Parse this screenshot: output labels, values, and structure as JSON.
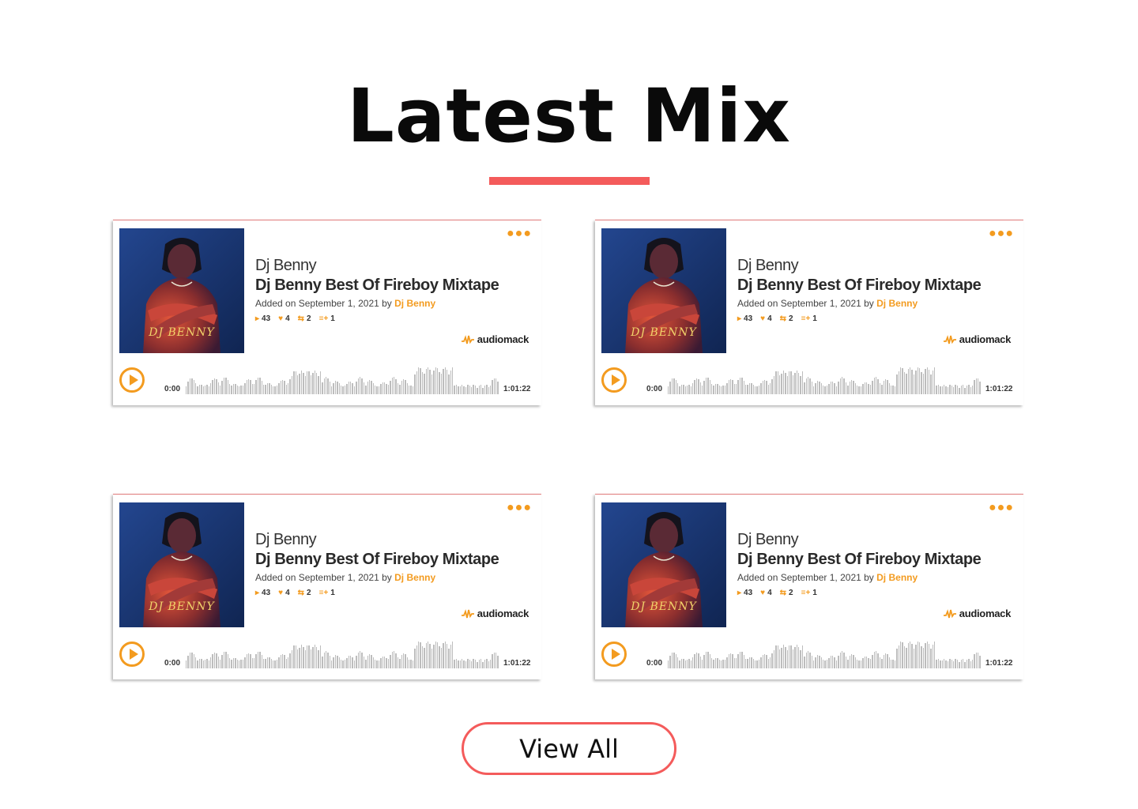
{
  "section": {
    "title": "Latest Mix",
    "view_all_label": "View All"
  },
  "colors": {
    "accent": "#f45b5b",
    "audiomack_orange": "#f39b1f",
    "waveform": "#bdbdbd"
  },
  "cards": [
    {
      "artwork_text": "DJ BENNY",
      "artist": "Dj Benny",
      "title": "Dj Benny Best Of Fireboy Mixtape",
      "added_prefix": "Added on September 1, 2021 by",
      "added_by": "Dj Benny",
      "plays": "43",
      "favorites": "4",
      "reposts": "2",
      "playlists": "1",
      "brand": "audiomack",
      "time_start": "0:00",
      "time_end": "1:01:22",
      "more_icon": "more-dots-icon",
      "play_icon": "play-icon"
    },
    {
      "artwork_text": "DJ BENNY",
      "artist": "Dj Benny",
      "title": "Dj Benny Best Of Fireboy Mixtape",
      "added_prefix": "Added on September 1, 2021 by",
      "added_by": "Dj Benny",
      "plays": "43",
      "favorites": "4",
      "reposts": "2",
      "playlists": "1",
      "brand": "audiomack",
      "time_start": "0:00",
      "time_end": "1:01:22",
      "more_icon": "more-dots-icon",
      "play_icon": "play-icon"
    },
    {
      "artwork_text": "DJ BENNY",
      "artist": "Dj Benny",
      "title": "Dj Benny Best Of Fireboy Mixtape",
      "added_prefix": "Added on September 1, 2021 by",
      "added_by": "Dj Benny",
      "plays": "43",
      "favorites": "4",
      "reposts": "2",
      "playlists": "1",
      "brand": "audiomack",
      "time_start": "0:00",
      "time_end": "1:01:22",
      "more_icon": "more-dots-icon",
      "play_icon": "play-icon"
    },
    {
      "artwork_text": "DJ BENNY",
      "artist": "Dj Benny",
      "title": "Dj Benny Best Of Fireboy Mixtape",
      "added_prefix": "Added on September 1, 2021 by",
      "added_by": "Dj Benny",
      "plays": "43",
      "favorites": "4",
      "reposts": "2",
      "playlists": "1",
      "brand": "audiomack",
      "time_start": "0:00",
      "time_end": "1:01:22",
      "more_icon": "more-dots-icon",
      "play_icon": "play-icon"
    }
  ]
}
